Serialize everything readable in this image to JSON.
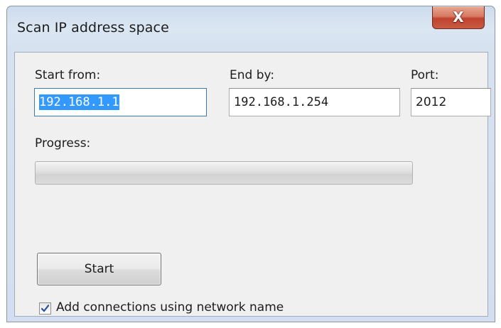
{
  "window": {
    "title": "Scan IP address space",
    "close_symbol": "X",
    "close_icon": "close-icon"
  },
  "fields": {
    "start": {
      "label": "Start from:",
      "value": "192.168.1.1",
      "selected": true
    },
    "end": {
      "label": "End by:",
      "value": "192.168.1.254"
    },
    "port": {
      "label": "Port:",
      "value": "2012"
    }
  },
  "progress": {
    "label": "Progress:",
    "value": 0
  },
  "actions": {
    "start_label": "Start"
  },
  "options": {
    "add_connections_label": "Add connections using network name",
    "add_connections_checked": true
  },
  "colors": {
    "selection": "#3399ff",
    "close_button": "#c0432d",
    "focus_border": "#3d7bad"
  }
}
